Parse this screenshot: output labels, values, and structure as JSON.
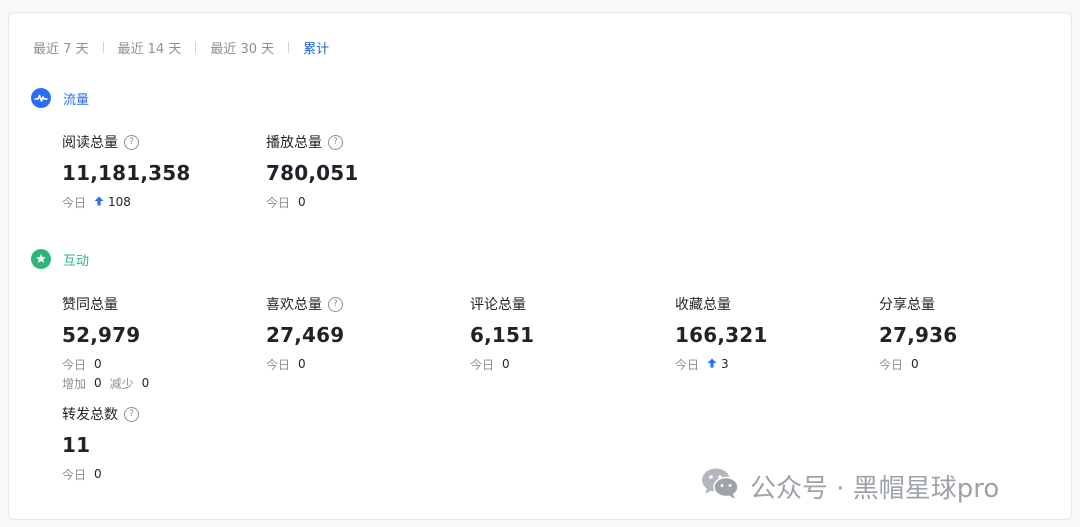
{
  "range_tabs": [
    {
      "label": "最近 7 天",
      "active": false
    },
    {
      "label": "最近 14 天",
      "active": false
    },
    {
      "label": "最近 30 天",
      "active": false
    },
    {
      "label": "累计",
      "active": true
    }
  ],
  "sections": {
    "traffic": {
      "title": "流量",
      "icon": "pulse-icon",
      "color": "#2b6ef6",
      "metrics": {
        "reads": {
          "label": "阅读总量",
          "value": "11,181,358",
          "today_label": "今日",
          "today_value": "108",
          "trend": "up"
        },
        "plays": {
          "label": "播放总量",
          "value": "780,051",
          "today_label": "今日",
          "today_value": "0"
        }
      }
    },
    "interaction": {
      "title": "互动",
      "icon": "star-icon",
      "color": "#2fb57c",
      "metrics": {
        "likes": {
          "label": "赞同总量",
          "value": "52,979",
          "today_label": "今日",
          "today_value": "0",
          "increase_label": "增加",
          "increase_value": "0",
          "decrease_label": "减少",
          "decrease_value": "0"
        },
        "favorites": {
          "label": "喜欢总量",
          "value": "27,469",
          "today_label": "今日",
          "today_value": "0"
        },
        "comments": {
          "label": "评论总量",
          "value": "6,151",
          "today_label": "今日",
          "today_value": "0"
        },
        "collections": {
          "label": "收藏总量",
          "value": "166,321",
          "today_label": "今日",
          "today_value": "3",
          "trend": "up"
        },
        "shares": {
          "label": "分享总量",
          "value": "27,936",
          "today_label": "今日",
          "today_value": "0"
        },
        "forwards": {
          "label": "转发总数",
          "value": "11",
          "today_label": "今日",
          "today_value": "0"
        }
      }
    }
  },
  "help_glyph": "?",
  "accent_color": "#1f64d6",
  "trend_up_color": "#2b6ef6",
  "watermark": {
    "text": "公众号 · 黑帽星球pro",
    "icon": "wechat-icon"
  }
}
